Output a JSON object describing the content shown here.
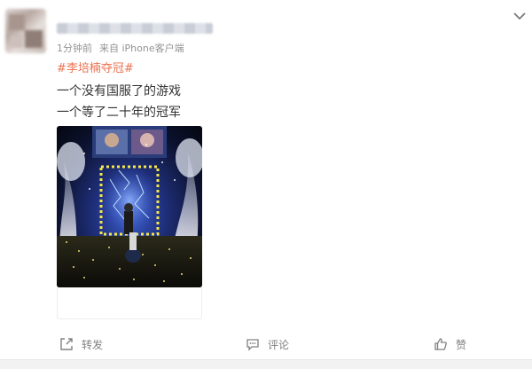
{
  "post": {
    "time": "1分钟前",
    "source": "来自 iPhone客户端",
    "hashtag": "#李培楠夺冠#",
    "lines": [
      "一个没有国服了的游戏",
      "一个等了二十年的冠军"
    ]
  },
  "actions": {
    "repost": "转发",
    "comment": "评论",
    "like": "赞"
  },
  "icons": {
    "menu": "chevron-down-icon",
    "repost": "share-icon",
    "comment": "comment-icon",
    "like": "thumbs-up-icon"
  },
  "colors": {
    "hashtag": "#eb7350",
    "meta": "#939393",
    "text": "#333333"
  }
}
